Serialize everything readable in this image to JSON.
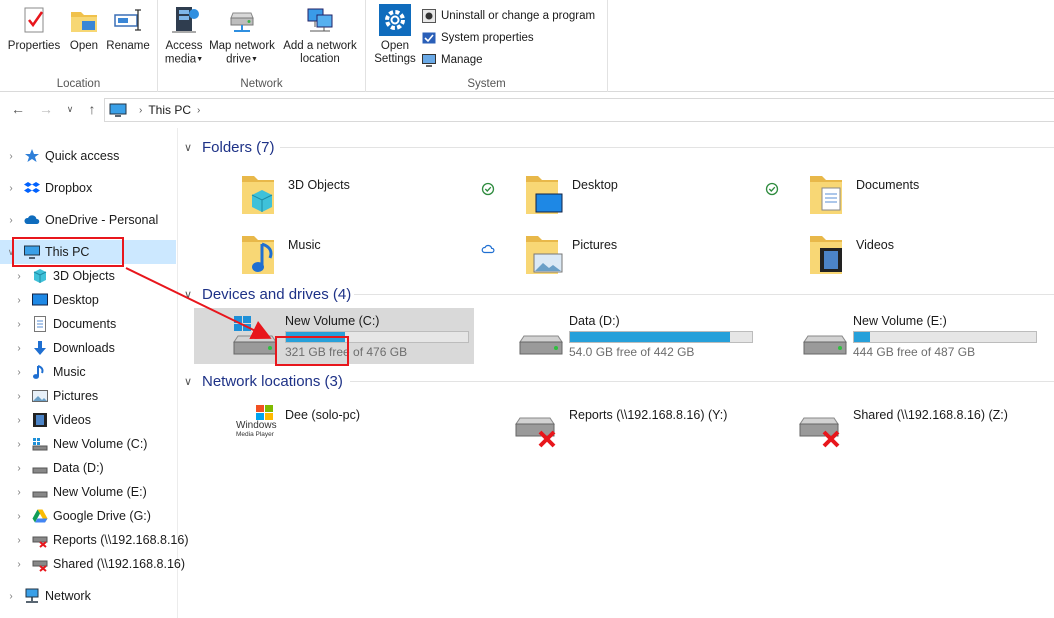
{
  "ribbon": {
    "location": {
      "label": "Location",
      "buttons": [
        {
          "label": "Properties",
          "icon": "properties-icon"
        },
        {
          "label": "Open",
          "icon": "folder-open-icon"
        },
        {
          "label": "Rename",
          "icon": "rename-icon"
        }
      ]
    },
    "network": {
      "label": "Network",
      "access_media": [
        "Access",
        "media"
      ],
      "map_drive": [
        "Map network",
        "drive"
      ],
      "add_location": [
        "Add a network",
        "location"
      ]
    },
    "system": {
      "label": "System",
      "open_settings": [
        "Open",
        "Settings"
      ],
      "uninstall": "Uninstall or change a program",
      "system_properties": "System properties",
      "manage": "Manage"
    }
  },
  "address": {
    "breadcrumb": "This PC",
    "separator": "›"
  },
  "sidebar": {
    "items": [
      {
        "label": "Quick access",
        "icon": "star-icon"
      },
      {
        "label": "Dropbox",
        "icon": "dropbox-icon"
      },
      {
        "label": "OneDrive - Personal",
        "icon": "cloud-icon"
      },
      {
        "label": "This PC",
        "icon": "computer-icon"
      },
      {
        "label": "3D Objects",
        "icon": "cube-icon"
      },
      {
        "label": "Desktop",
        "icon": "desktop-icon"
      },
      {
        "label": "Documents",
        "icon": "document-icon"
      },
      {
        "label": "Downloads",
        "icon": "download-icon"
      },
      {
        "label": "Music",
        "icon": "music-icon"
      },
      {
        "label": "Pictures",
        "icon": "picture-icon"
      },
      {
        "label": "Videos",
        "icon": "video-icon"
      },
      {
        "label": "New Volume (C:)",
        "icon": "drive-icon"
      },
      {
        "label": "Data (D:)",
        "icon": "drive-icon"
      },
      {
        "label": "New Volume (E:)",
        "icon": "drive-icon"
      },
      {
        "label": "Google Drive (G:)",
        "icon": "google-drive-icon"
      },
      {
        "label": "Reports (\\\\192.168.8.16)",
        "icon": "network-drive-disconnected-icon"
      },
      {
        "label": "Shared (\\\\192.168.8.16)",
        "icon": "network-drive-disconnected-icon"
      },
      {
        "label": "Network",
        "icon": "network-icon"
      }
    ]
  },
  "groups": {
    "folders": {
      "title": "Folders (7)",
      "items": [
        {
          "label": "3D Objects",
          "icon": "3d-objects-folder-icon",
          "status": ""
        },
        {
          "label": "Desktop",
          "icon": "desktop-folder-icon",
          "status": "synced"
        },
        {
          "label": "Documents",
          "icon": "documents-folder-icon",
          "status": "synced"
        },
        {
          "label": "Music",
          "icon": "music-folder-icon",
          "status": ""
        },
        {
          "label": "Pictures",
          "icon": "pictures-folder-icon",
          "status": "cloud"
        },
        {
          "label": "Videos",
          "icon": "videos-folder-icon",
          "status": ""
        }
      ]
    },
    "drives": {
      "title": "Devices and drives (4)",
      "items": [
        {
          "label": "New Volume (C:)",
          "free": "321 GB free of 476 GB",
          "used_fraction": 0.326
        },
        {
          "label": "Data (D:)",
          "free": "54.0 GB free of 442 GB",
          "used_fraction": 0.878
        },
        {
          "label": "New Volume (E:)",
          "free": "444 GB free of 487 GB",
          "used_fraction": 0.088
        }
      ]
    },
    "network": {
      "title": "Network locations (3)",
      "items": [
        {
          "label": "Dee (solo-pc)",
          "icon": "windows-media-player-icon",
          "logo_text": [
            "Windows",
            "Media Player"
          ]
        },
        {
          "label": "Reports (\\\\192.168.8.16) (Y:)",
          "icon": "network-drive-disconnected-icon"
        },
        {
          "label": "Shared (\\\\192.168.8.16) (Z:)",
          "icon": "network-drive-disconnected-icon"
        }
      ]
    }
  },
  "colors": {
    "accent": "#26a0da",
    "selection": "#cce8ff",
    "group_header": "#1e3287",
    "annotation": "#e8161c"
  }
}
